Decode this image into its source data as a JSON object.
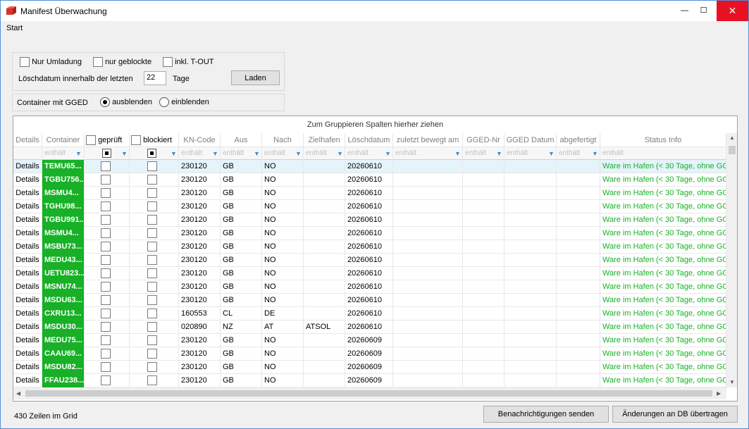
{
  "window": {
    "title": "Manifest Überwachung",
    "min_glyph": "—",
    "max_glyph": "☐",
    "close_glyph": "✕",
    "icon": "app-icon"
  },
  "menu": {
    "start": "Start"
  },
  "options": {
    "nur_umladung": "Nur Umladung",
    "nur_geblockte": "nur geblockte",
    "inkl_tout": "inkl. T-OUT",
    "loeschdatum_label": "Löschdatum innerhalb der letzten",
    "loeschdatum_value": "22",
    "tage": "Tage",
    "laden": "Laden"
  },
  "gged": {
    "label": "Container mit GGED",
    "ausblenden": "ausblenden",
    "einblenden": "einblenden",
    "selected": "ausblenden"
  },
  "grid": {
    "group_hint": "Zum Gruppieren Spalten hierher ziehen",
    "headers": {
      "details": "Details",
      "container": "Container",
      "geprueft": "geprüft",
      "blockiert": "blockiert",
      "kn_code": "KN-Code",
      "aus": "Aus",
      "nach": "Nach",
      "zielhafen": "Zielhafen",
      "loeschdatum": "Löschdatum",
      "zuletzt": "zuletzt bewegt am",
      "gged_nr": "GGED-Nr",
      "gged_datum": "GGED Datum",
      "abgefertigt": "abgefertigt",
      "status": "Status Info"
    },
    "filter_placeholder": "enthält",
    "details_label": "Details",
    "rows": [
      {
        "container": "TEMU65...",
        "kn": "230120",
        "aus": "GB",
        "nach": "NO",
        "ziel": "",
        "datum": "20260610",
        "status": "Ware im Hafen (< 30 Tage, ohne GG"
      },
      {
        "container": "TGBU756...",
        "kn": "230120",
        "aus": "GB",
        "nach": "NO",
        "ziel": "",
        "datum": "20260610",
        "status": "Ware im Hafen (< 30 Tage, ohne GG"
      },
      {
        "container": "MSMU4...",
        "kn": "230120",
        "aus": "GB",
        "nach": "NO",
        "ziel": "",
        "datum": "20260610",
        "status": "Ware im Hafen (< 30 Tage, ohne GG"
      },
      {
        "container": "TGHU98...",
        "kn": "230120",
        "aus": "GB",
        "nach": "NO",
        "ziel": "",
        "datum": "20260610",
        "status": "Ware im Hafen (< 30 Tage, ohne GG"
      },
      {
        "container": "TGBU991...",
        "kn": "230120",
        "aus": "GB",
        "nach": "NO",
        "ziel": "",
        "datum": "20260610",
        "status": "Ware im Hafen (< 30 Tage, ohne GG"
      },
      {
        "container": "MSMU4...",
        "kn": "230120",
        "aus": "GB",
        "nach": "NO",
        "ziel": "",
        "datum": "20260610",
        "status": "Ware im Hafen (< 30 Tage, ohne GG"
      },
      {
        "container": "MSBU73...",
        "kn": "230120",
        "aus": "GB",
        "nach": "NO",
        "ziel": "",
        "datum": "20260610",
        "status": "Ware im Hafen (< 30 Tage, ohne GG"
      },
      {
        "container": "MEDU43...",
        "kn": "230120",
        "aus": "GB",
        "nach": "NO",
        "ziel": "",
        "datum": "20260610",
        "status": "Ware im Hafen (< 30 Tage, ohne GG"
      },
      {
        "container": "UETU823...",
        "kn": "230120",
        "aus": "GB",
        "nach": "NO",
        "ziel": "",
        "datum": "20260610",
        "status": "Ware im Hafen (< 30 Tage, ohne GG"
      },
      {
        "container": "MSNU74...",
        "kn": "230120",
        "aus": "GB",
        "nach": "NO",
        "ziel": "",
        "datum": "20260610",
        "status": "Ware im Hafen (< 30 Tage, ohne GG"
      },
      {
        "container": "MSDU63...",
        "kn": "230120",
        "aus": "GB",
        "nach": "NO",
        "ziel": "",
        "datum": "20260610",
        "status": "Ware im Hafen (< 30 Tage, ohne GG"
      },
      {
        "container": "CXRU13...",
        "kn": "160553",
        "aus": "CL",
        "nach": "DE",
        "ziel": "",
        "datum": "20260610",
        "status": "Ware im Hafen (< 30 Tage, ohne GG"
      },
      {
        "container": "MSDU30...",
        "kn": "020890",
        "aus": "NZ",
        "nach": "AT",
        "ziel": "ATSOL",
        "datum": "20260610",
        "status": "Ware im Hafen (< 30 Tage, ohne GG"
      },
      {
        "container": "MEDU75...",
        "kn": "230120",
        "aus": "GB",
        "nach": "NO",
        "ziel": "",
        "datum": "20260609",
        "status": "Ware im Hafen (< 30 Tage, ohne GG"
      },
      {
        "container": "CAAU69...",
        "kn": "230120",
        "aus": "GB",
        "nach": "NO",
        "ziel": "",
        "datum": "20260609",
        "status": "Ware im Hafen (< 30 Tage, ohne GG"
      },
      {
        "container": "MSDU82...",
        "kn": "230120",
        "aus": "GB",
        "nach": "NO",
        "ziel": "",
        "datum": "20260609",
        "status": "Ware im Hafen (< 30 Tage, ohne GG"
      },
      {
        "container": "FFAU238...",
        "kn": "230120",
        "aus": "GB",
        "nach": "NO",
        "ziel": "",
        "datum": "20260609",
        "status": "Ware im Hafen (< 30 Tage, ohne GG"
      }
    ]
  },
  "footer": {
    "row_count": "430 Zeilen im Grid",
    "notify_button": "Benachrichtigungen senden",
    "commit_button": "Änderungen an DB übertragen"
  },
  "colors": {
    "container_green": "#17b026",
    "status_green": "#17b026",
    "close_red": "#e81123",
    "selected_row": "#e5f3fb"
  }
}
